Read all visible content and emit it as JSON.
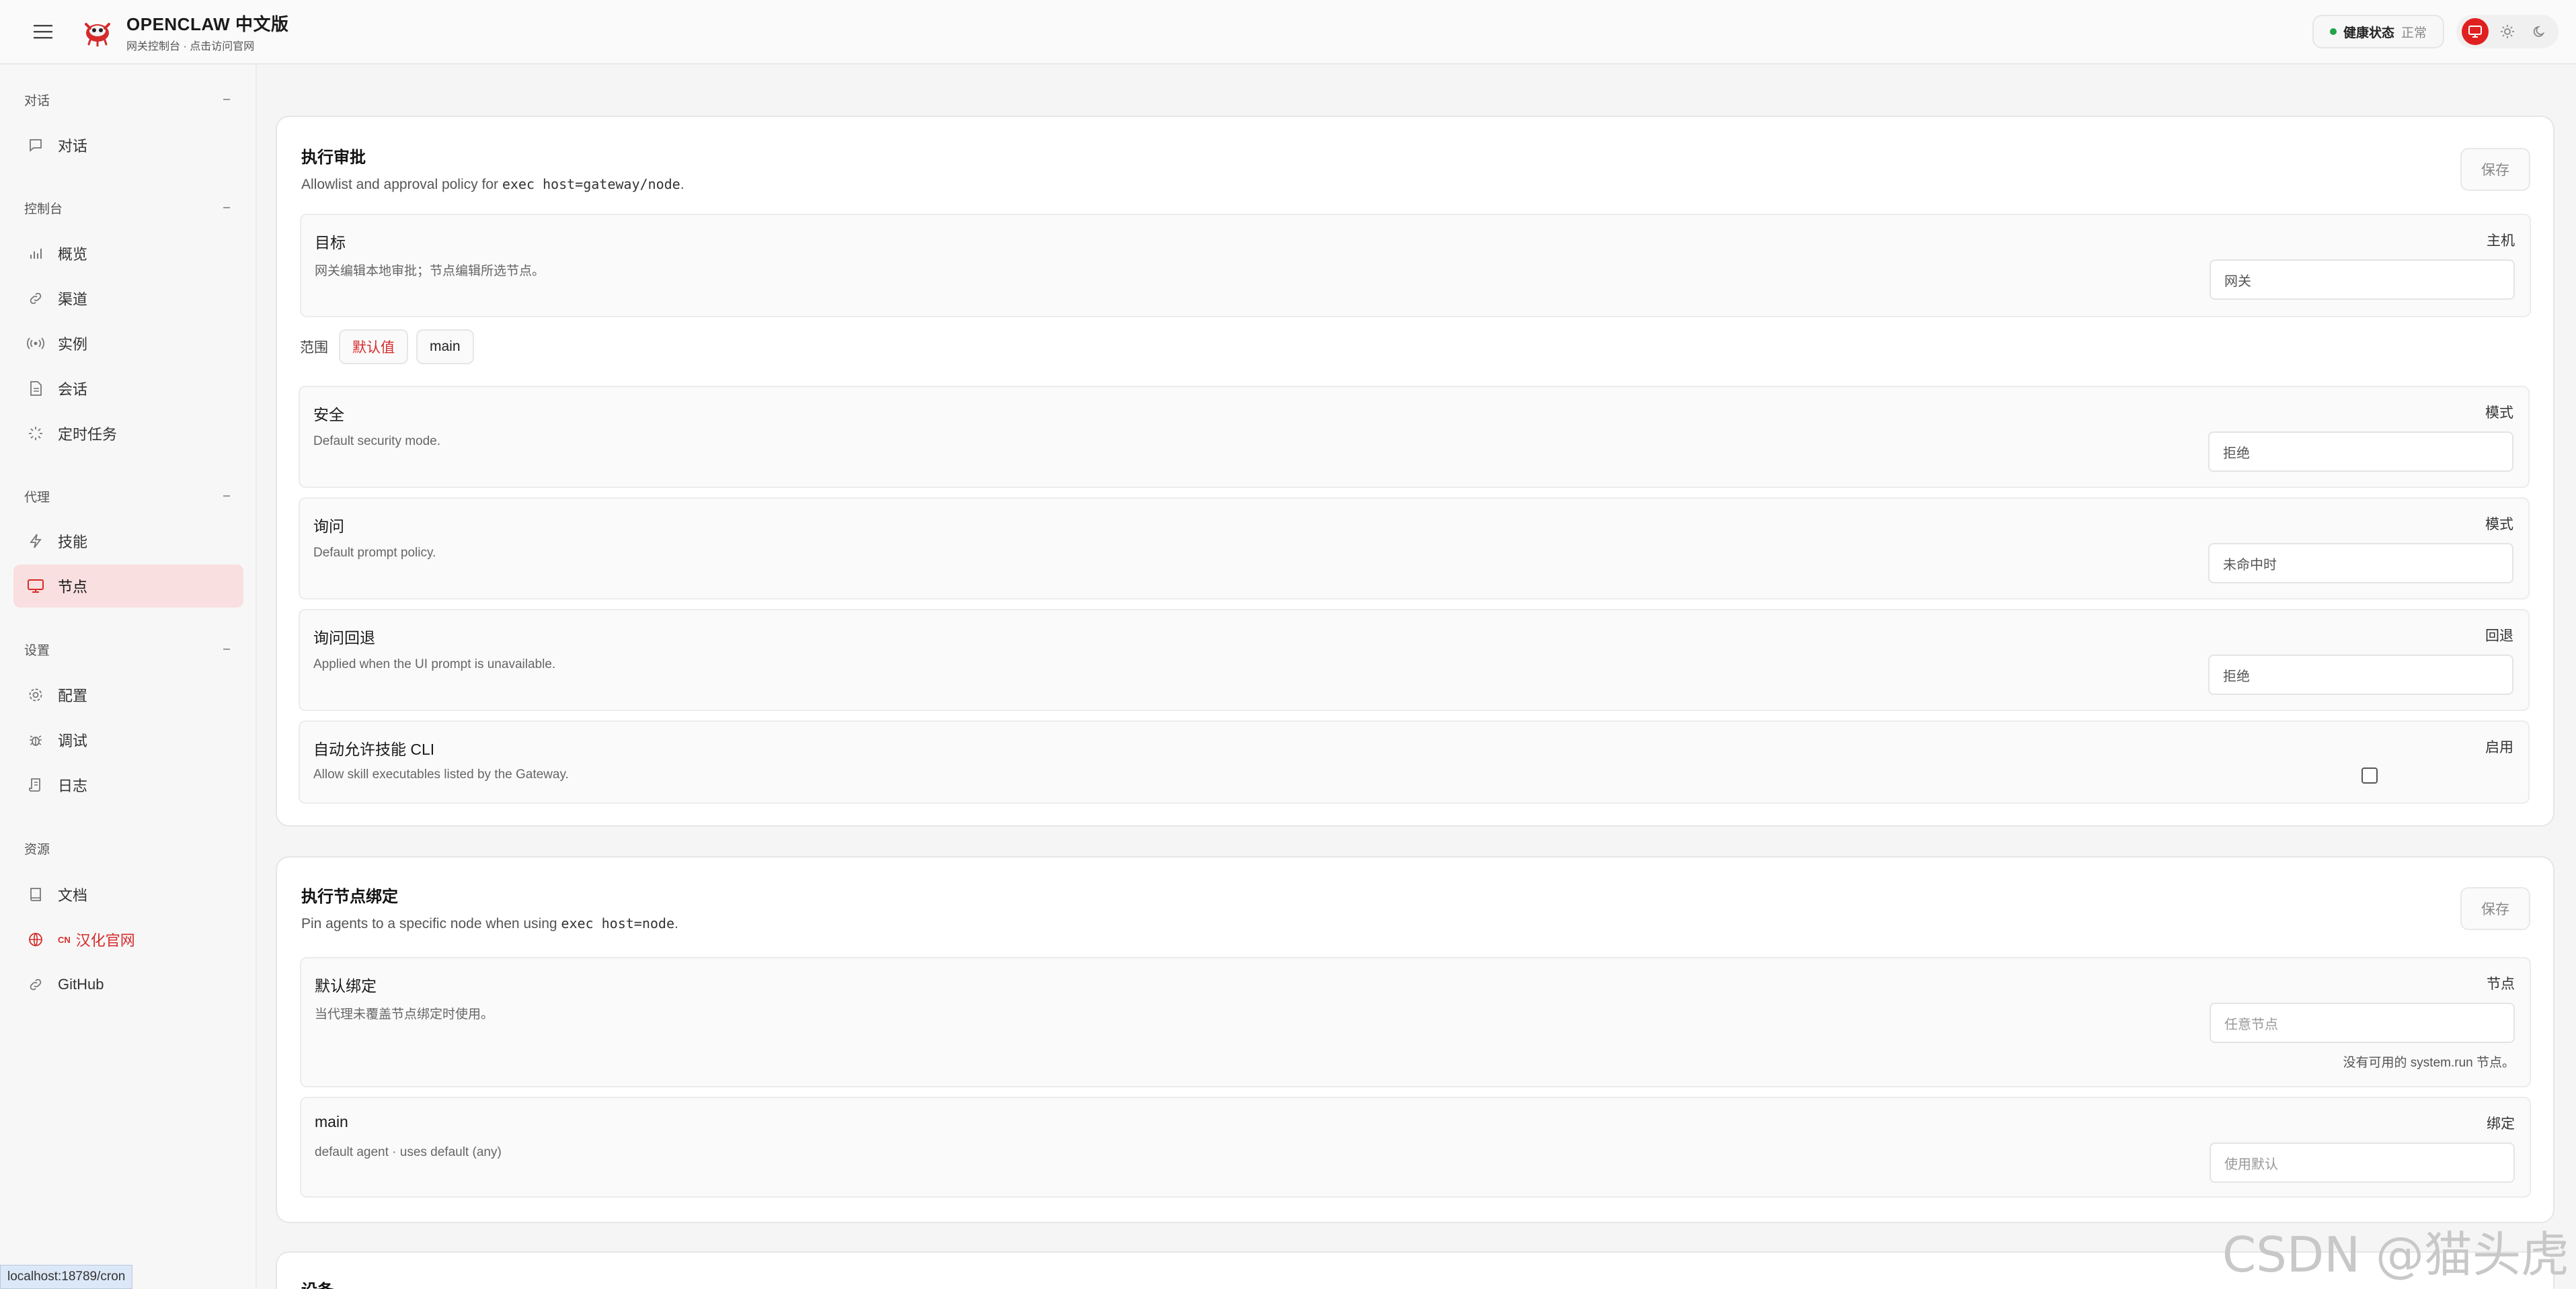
{
  "header": {
    "brand_title": "OPENCLAW 中文版",
    "brand_sub": "网关控制台 · 点击访问官网",
    "health_label": "健康状态",
    "health_value": "正常"
  },
  "sidebar": {
    "sections": {
      "chat": "对话",
      "control": "控制台",
      "agent": "代理",
      "settings": "设置",
      "resources": "资源"
    },
    "items": {
      "chat": "对话",
      "overview": "概览",
      "channels": "渠道",
      "instances": "实例",
      "sessions": "会话",
      "cron": "定时任务",
      "skills": "技能",
      "nodes": "节点",
      "config": "配置",
      "debug": "调试",
      "logs": "日志",
      "docs": "文档",
      "cn_tag": "CN",
      "cn_site": "汉化官网",
      "github": "GitHub"
    }
  },
  "status_url": "localhost:18789/cron",
  "exec_approval": {
    "title": "执行审批",
    "desc_prefix": "Allowlist and approval policy for ",
    "desc_code": "exec host=gateway/node",
    "desc_suffix": ".",
    "save": "保存",
    "target": {
      "title": "目标",
      "desc": "网关编辑本地审批；节点编辑所选节点。",
      "label": "主机",
      "value": "网关"
    },
    "scope": {
      "label": "范围",
      "chips": [
        "默认值",
        "main"
      ]
    },
    "security": {
      "title": "安全",
      "desc": "Default security mode.",
      "label": "模式",
      "value": "拒绝"
    },
    "ask": {
      "title": "询问",
      "desc": "Default prompt policy.",
      "label": "模式",
      "value": "未命中时"
    },
    "ask_fallback": {
      "title": "询问回退",
      "desc": "Applied when the UI prompt is unavailable.",
      "label": "回退",
      "value": "拒绝"
    },
    "auto_allow": {
      "title": "自动允许技能 CLI",
      "desc": "Allow skill executables listed by the Gateway.",
      "label": "启用"
    }
  },
  "exec_binding": {
    "title": "执行节点绑定",
    "desc_prefix": "Pin agents to a specific node when using ",
    "desc_code": "exec host=node",
    "desc_suffix": ".",
    "save": "保存",
    "default_binding": {
      "title": "默认绑定",
      "desc": "当代理未覆盖节点绑定时使用。",
      "label": "节点",
      "placeholder": "任意节点",
      "note": "没有可用的 system.run 节点。"
    },
    "main": {
      "title": "main",
      "desc": "default agent · uses default (any)",
      "label": "绑定",
      "placeholder": "使用默认"
    }
  },
  "devices": {
    "title": "设备"
  },
  "watermark": "CSDN @猫头虎",
  "colors": {
    "accent": "#e02020",
    "active_bg": "#f9dfe0",
    "health": "#22a447"
  }
}
